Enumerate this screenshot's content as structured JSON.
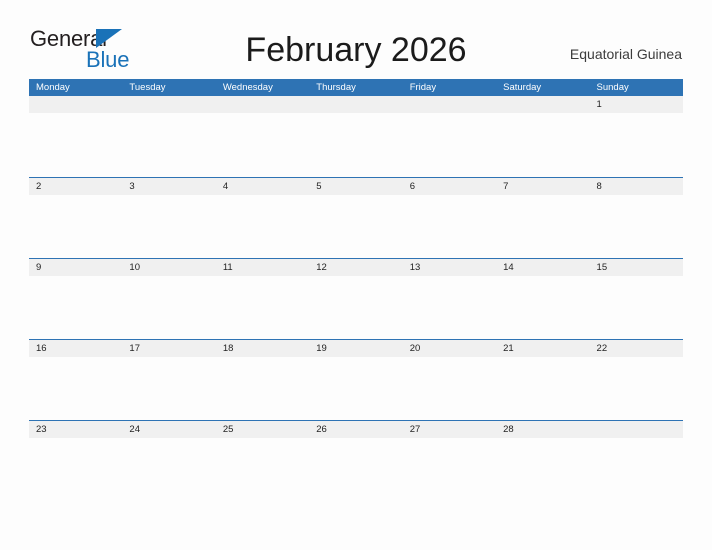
{
  "logo": {
    "word_one": "General",
    "word_two": "Blue",
    "flag_icon": "flag-triangle-icon",
    "primary_color": "#1a72b8",
    "text_color": "#231f20"
  },
  "header": {
    "title": "February 2026",
    "region": "Equatorial Guinea"
  },
  "calendar": {
    "header_color": "#2e73b4",
    "band_color": "#f0f0f0",
    "weekdays": [
      "Monday",
      "Tuesday",
      "Wednesday",
      "Thursday",
      "Friday",
      "Saturday",
      "Sunday"
    ],
    "weeks": [
      {
        "rule": false,
        "days": [
          {
            "num": "",
            "filled": true
          },
          {
            "num": "",
            "filled": true
          },
          {
            "num": "",
            "filled": true
          },
          {
            "num": "",
            "filled": true
          },
          {
            "num": "",
            "filled": true
          },
          {
            "num": "",
            "filled": true
          },
          {
            "num": "1",
            "filled": true
          }
        ]
      },
      {
        "rule": true,
        "days": [
          {
            "num": "2",
            "filled": true
          },
          {
            "num": "3",
            "filled": true
          },
          {
            "num": "4",
            "filled": true
          },
          {
            "num": "5",
            "filled": true
          },
          {
            "num": "6",
            "filled": true
          },
          {
            "num": "7",
            "filled": true
          },
          {
            "num": "8",
            "filled": true
          }
        ]
      },
      {
        "rule": true,
        "days": [
          {
            "num": "9",
            "filled": true
          },
          {
            "num": "10",
            "filled": true
          },
          {
            "num": "11",
            "filled": true
          },
          {
            "num": "12",
            "filled": true
          },
          {
            "num": "13",
            "filled": true
          },
          {
            "num": "14",
            "filled": true
          },
          {
            "num": "15",
            "filled": true
          }
        ]
      },
      {
        "rule": true,
        "days": [
          {
            "num": "16",
            "filled": true
          },
          {
            "num": "17",
            "filled": true
          },
          {
            "num": "18",
            "filled": true
          },
          {
            "num": "19",
            "filled": true
          },
          {
            "num": "20",
            "filled": true
          },
          {
            "num": "21",
            "filled": true
          },
          {
            "num": "22",
            "filled": true
          }
        ]
      },
      {
        "rule": true,
        "days": [
          {
            "num": "23",
            "filled": true
          },
          {
            "num": "24",
            "filled": true
          },
          {
            "num": "25",
            "filled": true
          },
          {
            "num": "26",
            "filled": true
          },
          {
            "num": "27",
            "filled": true
          },
          {
            "num": "28",
            "filled": true
          },
          {
            "num": "",
            "filled": true
          }
        ]
      }
    ]
  }
}
